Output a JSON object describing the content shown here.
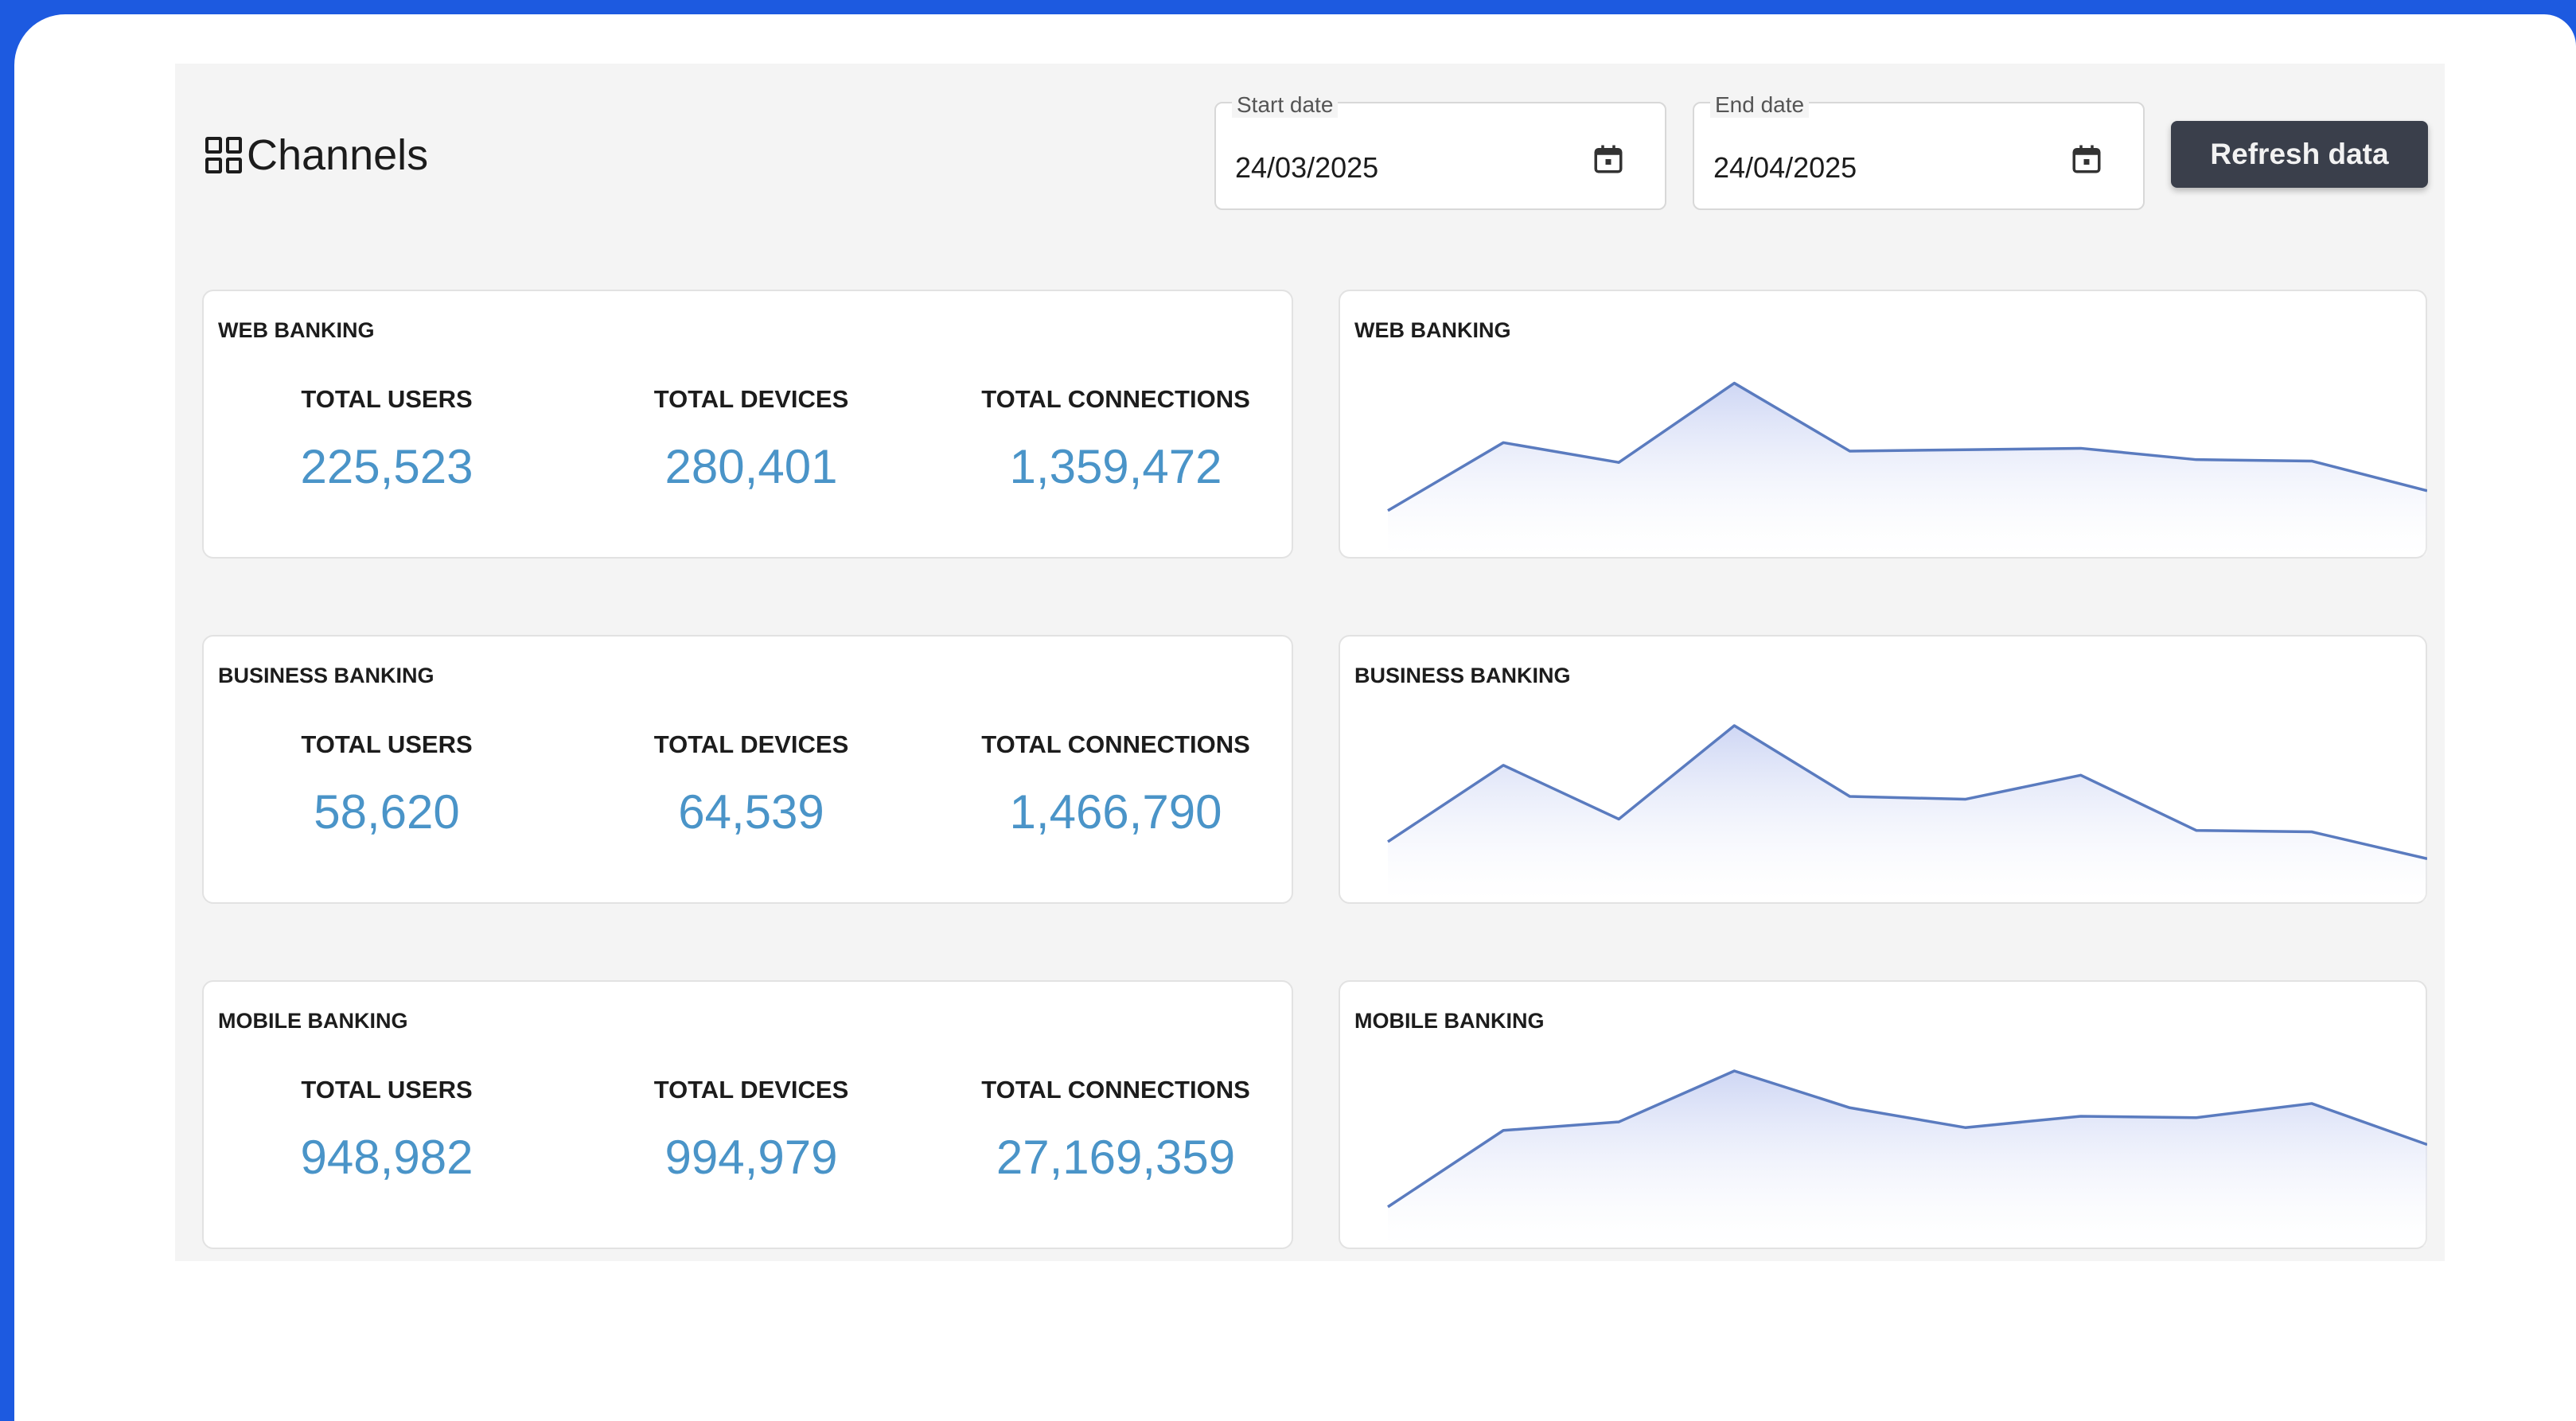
{
  "page": {
    "title": "Channels",
    "title_icon": "grid-view-icon"
  },
  "filters": {
    "start": {
      "label": "Start date",
      "value": "24/03/2025",
      "icon": "calendar-icon"
    },
    "end": {
      "label": "End date",
      "value": "24/04/2025",
      "icon": "calendar-icon"
    },
    "refresh_label": "Refresh data"
  },
  "channels": [
    {
      "name": "WEB BANKING",
      "stats": [
        {
          "label": "TOTAL USERS",
          "value": "225,523"
        },
        {
          "label": "TOTAL DEVICES",
          "value": "280,401"
        },
        {
          "label": "TOTAL CONNECTIONS",
          "value": "1,359,472"
        }
      ],
      "chart_title": "WEB BANKING"
    },
    {
      "name": "BUSINESS BANKING",
      "stats": [
        {
          "label": "TOTAL USERS",
          "value": "58,620"
        },
        {
          "label": "TOTAL DEVICES",
          "value": "64,539"
        },
        {
          "label": "TOTAL CONNECTIONS",
          "value": "1,466,790"
        }
      ],
      "chart_title": "BUSINESS BANKING"
    },
    {
      "name": "MOBILE BANKING",
      "stats": [
        {
          "label": "TOTAL USERS",
          "value": "948,982"
        },
        {
          "label": "TOTAL DEVICES",
          "value": "994,979"
        },
        {
          "label": "TOTAL CONNECTIONS",
          "value": "27,169,359"
        }
      ],
      "chart_title": "MOBILE BANKING"
    }
  ],
  "chart_data": [
    {
      "type": "area",
      "title": "WEB BANKING",
      "values": [
        0.08,
        0.56,
        0.42,
        0.98,
        0.5,
        0.51,
        0.52,
        0.44,
        0.43,
        0.22
      ]
    },
    {
      "type": "area",
      "title": "BUSINESS BANKING",
      "values": [
        0.18,
        0.72,
        0.34,
        1.0,
        0.5,
        0.48,
        0.65,
        0.26,
        0.25,
        0.06
      ]
    },
    {
      "type": "area",
      "title": "MOBILE BANKING",
      "values": [
        0.04,
        0.58,
        0.64,
        1.0,
        0.74,
        0.6,
        0.68,
        0.67,
        0.77,
        0.48
      ]
    }
  ],
  "colors": {
    "accent_number": "#4a94c8",
    "line": "#5a7bbf",
    "area_top": "#c9d2f3",
    "button_bg": "#3a3f4b",
    "frame_blue": "#1d5ae0"
  }
}
